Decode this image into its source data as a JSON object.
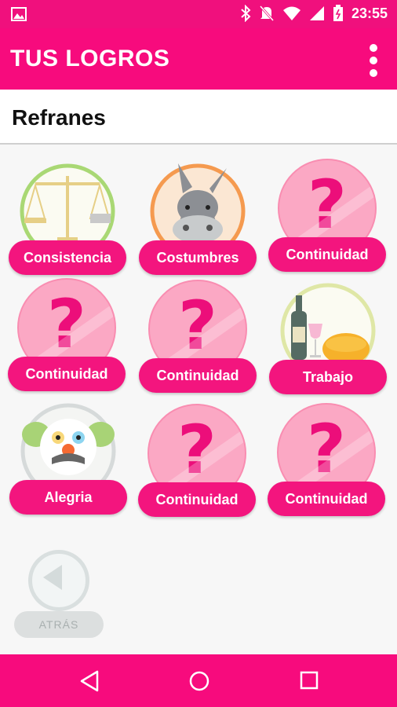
{
  "status_bar": {
    "time": "23:55"
  },
  "app_bar": {
    "title": "TUS LOGROS"
  },
  "section": {
    "title": "Refranes"
  },
  "badges": [
    {
      "label": "Consistencia",
      "icon": "scales-icon",
      "locked": false
    },
    {
      "label": "Costumbres",
      "icon": "donkey-icon",
      "locked": false
    },
    {
      "label": "Continuidad",
      "icon": "question-icon",
      "locked": true
    },
    {
      "label": "Continuidad",
      "icon": "question-icon",
      "locked": true
    },
    {
      "label": "Continuidad",
      "icon": "question-icon",
      "locked": true
    },
    {
      "label": "Trabajo",
      "icon": "wine-bread-icon",
      "locked": false
    },
    {
      "label": "Alegria",
      "icon": "clown-icon",
      "locked": false
    },
    {
      "label": "Continuidad",
      "icon": "question-icon",
      "locked": true
    },
    {
      "label": "Continuidad",
      "icon": "question-icon",
      "locked": true
    }
  ],
  "locked_glyph": "?",
  "back_button": {
    "label": "ATRÁS"
  },
  "colors": {
    "accent": "#f70b7d",
    "locked_circle": "#fba8c4",
    "label_pill": "#f3157e"
  }
}
